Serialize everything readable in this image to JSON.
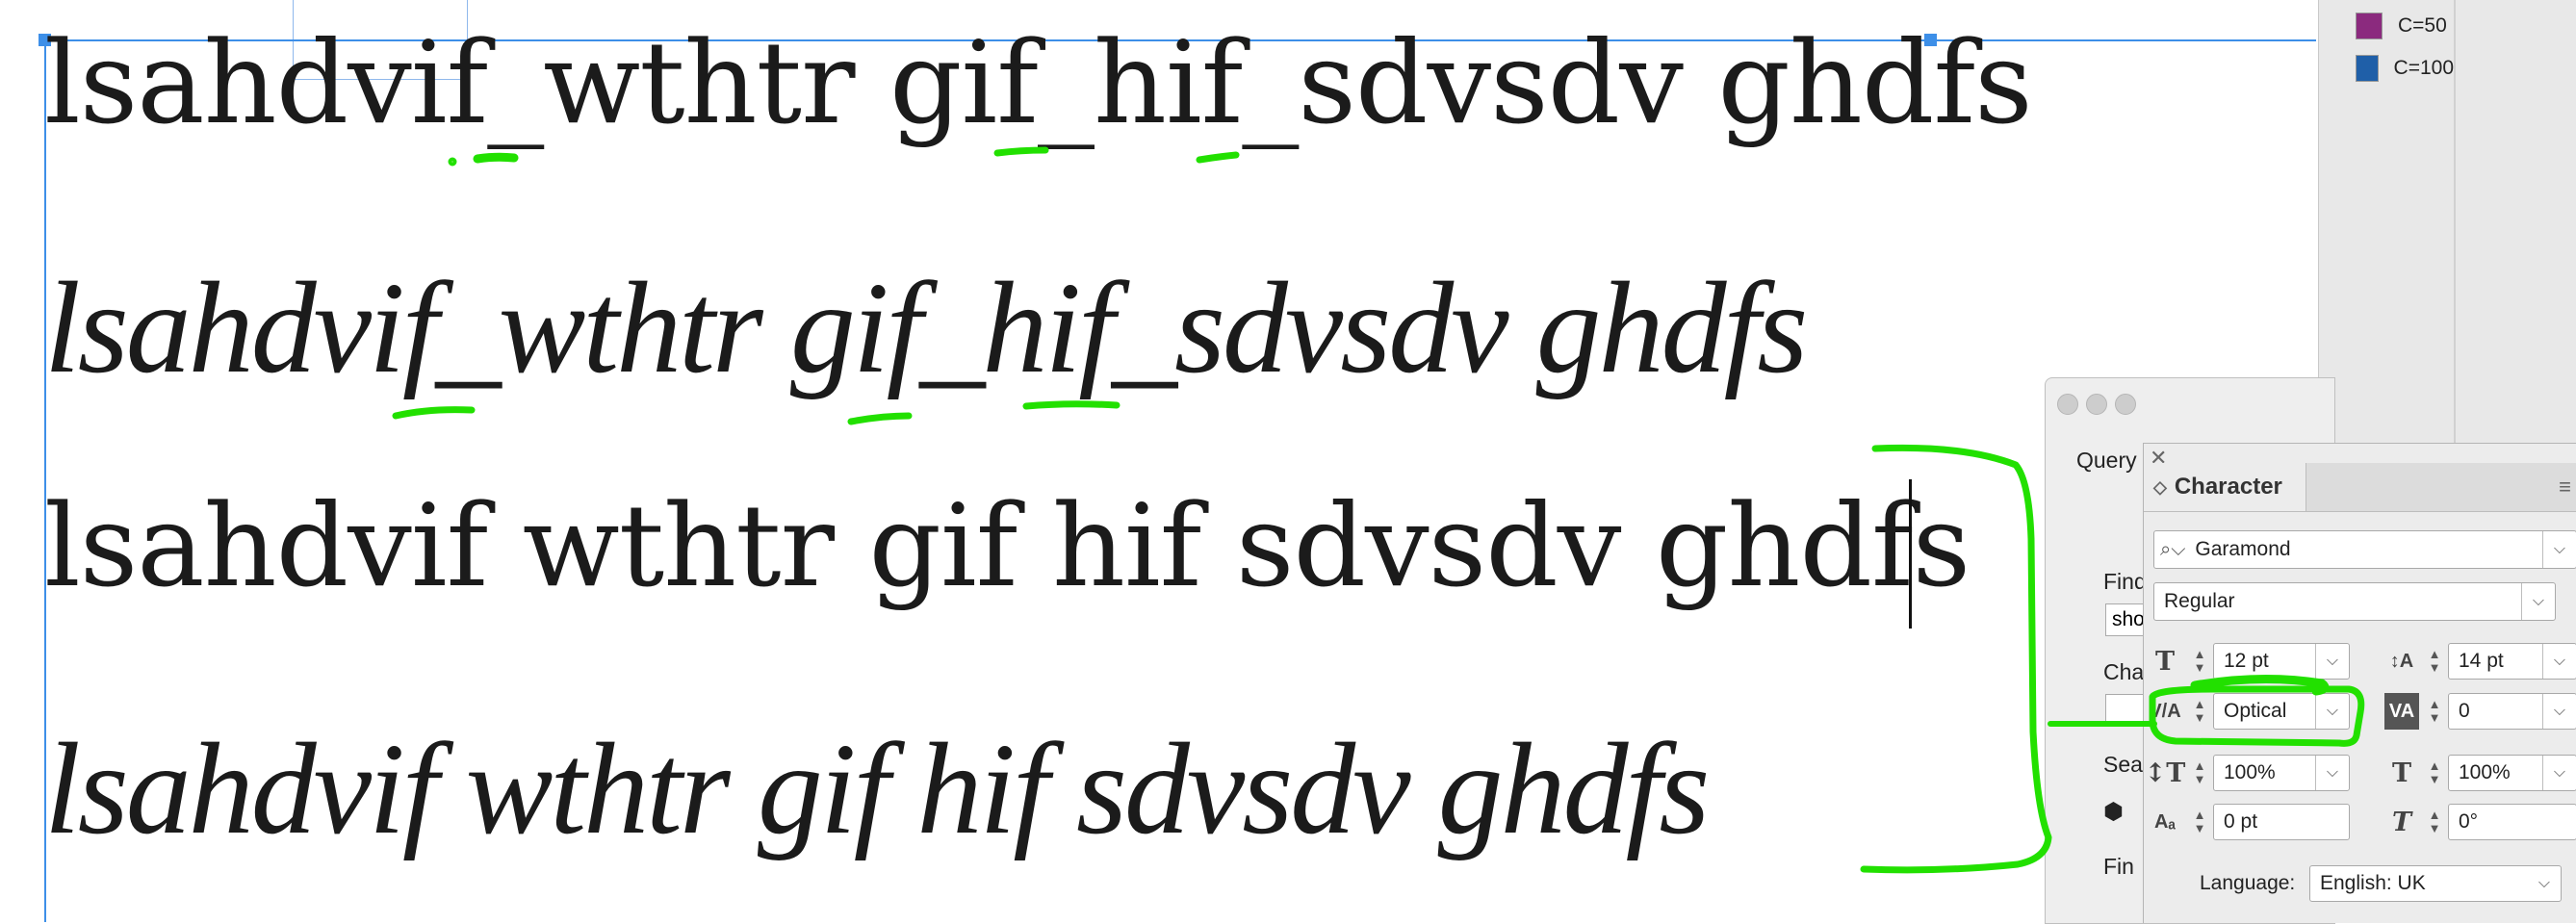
{
  "document": {
    "lines": [
      "lsahdvif_wthtr gif_hif_sdvsdv ghdfs",
      "lsahdvif_wthtr gif_hif_sdvsdv ghdfs",
      "lsahdvif wthtr gif hif sdvsdv ghdfs",
      "lsahdvif wthtr gif hif sdvsdv ghdfs"
    ]
  },
  "swatches": [
    {
      "label": "C=50",
      "color": "#8b2a7e"
    },
    {
      "label": "C=100",
      "color": "#1f5fa8"
    }
  ],
  "query_panel": {
    "query_label": "Query",
    "find_label": "Find",
    "find_value": "sho",
    "change_label": "Cha",
    "search_label": "Sea",
    "find2_label": "Fin"
  },
  "character_panel": {
    "title": "Character",
    "font_family": "Garamond",
    "font_style": "Regular",
    "font_size": "12 pt",
    "leading": "14 pt",
    "kerning": "Optical",
    "tracking": "0",
    "vertical_scale": "100%",
    "horizontal_scale": "100%",
    "baseline_shift": "0 pt",
    "skew": "0°",
    "language_label": "Language:",
    "language": "English: UK"
  },
  "annotation_color": "#22e000",
  "selection_color": "#3d8fe8"
}
